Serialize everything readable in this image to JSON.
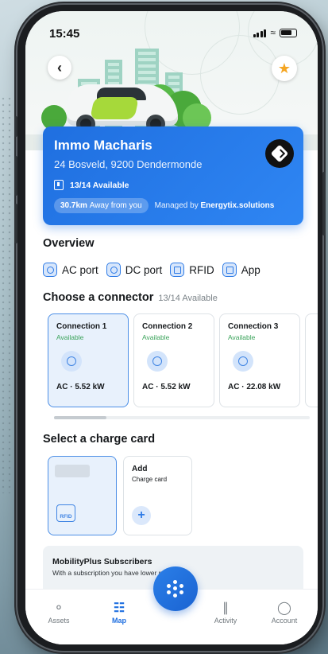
{
  "status_bar": {
    "time": "15:45"
  },
  "station": {
    "name": "Immo Macharis",
    "address": "24 Bosveld, 9200 Dendermonde",
    "availability": "13/14 Available",
    "distance": "30.7km",
    "distance_suffix": "Away from you",
    "managed_prefix": "Managed by",
    "managed_by": "Energytix.solutions"
  },
  "overview": {
    "title": "Overview",
    "features": [
      "AC port",
      "DC port",
      "RFID",
      "App"
    ]
  },
  "connectors": {
    "title": "Choose a connector",
    "availability": "13/14 Available",
    "items": [
      {
        "name": "Connection 1",
        "status": "Available",
        "power": "AC · 5.52 kW",
        "selected": true
      },
      {
        "name": "Connection 2",
        "status": "Available",
        "power": "AC · 5.52 kW",
        "selected": false
      },
      {
        "name": "Connection 3",
        "status": "Available",
        "power": "AC · 22.08 kW",
        "selected": false
      }
    ]
  },
  "charge_card": {
    "title": "Select a charge card",
    "rfid_label": "RFID",
    "add_title": "Add",
    "add_subtitle": "Charge card"
  },
  "subscribers": {
    "title": "MobilityPlus Subscribers",
    "subtitle": "With a subscription you have lower rates."
  },
  "tabbar": {
    "tabs": [
      {
        "label": "Assets",
        "icon": "assets-icon"
      },
      {
        "label": "Map",
        "icon": "map-icon",
        "active": true
      },
      {
        "label": "Activity",
        "icon": "activity-icon"
      },
      {
        "label": "Account",
        "icon": "account-icon"
      }
    ],
    "center_icon": "scan-dots-icon"
  },
  "colors": {
    "accent": "#1f6fe0",
    "available": "#3aa35a",
    "favorite": "#f5a623"
  }
}
